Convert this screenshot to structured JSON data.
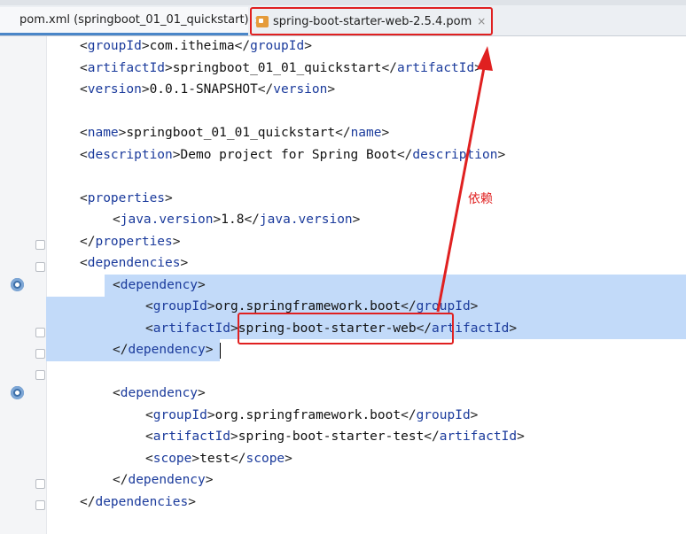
{
  "tabs": [
    {
      "label": "pom.xml (springboot_01_01_quickstart)",
      "close": "×"
    },
    {
      "label": "spring-boot-starter-web-2.5.4.pom",
      "close": "×"
    }
  ],
  "annotation": "依赖",
  "code": [
    {
      "indent": 0,
      "tag": "groupId",
      "value": "com.itheima"
    },
    {
      "indent": 0,
      "tag": "artifactId",
      "value": "springboot_01_01_quickstart"
    },
    {
      "indent": 0,
      "tag": "version",
      "value": "0.0.1-SNAPSHOT"
    },
    {
      "indent": 0,
      "tag": "name",
      "value": "springboot_01_01_quickstart"
    },
    {
      "indent": 0,
      "tag": "description",
      "value": "Demo project for Spring Boot"
    },
    {
      "indent": 0,
      "open": "properties"
    },
    {
      "indent": 1,
      "tag": "java.version",
      "value": "1.8"
    },
    {
      "indent": 0,
      "close": "properties"
    },
    {
      "indent": 0,
      "open": "dependencies"
    },
    {
      "indent": 1,
      "open": "dependency"
    },
    {
      "indent": 2,
      "tag": "groupId",
      "value": "org.springframework.boot"
    },
    {
      "indent": 2,
      "tag": "artifactId",
      "value": "spring-boot-starter-web"
    },
    {
      "indent": 1,
      "close": "dependency"
    },
    {
      "indent": 1,
      "open": "dependency"
    },
    {
      "indent": 2,
      "tag": "groupId",
      "value": "org.springframework.boot"
    },
    {
      "indent": 2,
      "tag": "artifactId",
      "value": "spring-boot-starter-test"
    },
    {
      "indent": 2,
      "tag": "scope",
      "value": "test"
    },
    {
      "indent": 1,
      "close": "dependency"
    },
    {
      "indent": 0,
      "close": "dependencies"
    }
  ],
  "colors": {
    "tag": "#1b3b9c",
    "selection": "#c2daf9",
    "highlight": "#e02020"
  }
}
